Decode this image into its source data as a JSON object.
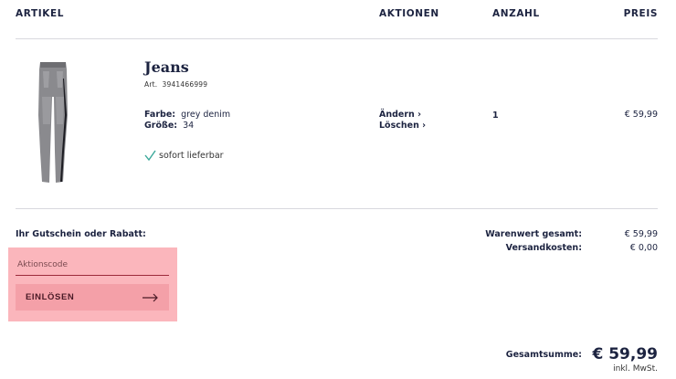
{
  "header": {
    "article": "ARTIKEL",
    "actions": "AKTIONEN",
    "quantity": "ANZAHL",
    "price": "PREIS"
  },
  "item": {
    "name": "Jeans",
    "article_label": "Art.",
    "article_number": "3941466999",
    "color_label": "Farbe:",
    "color_value": "grey denim",
    "size_label": "Größe:",
    "size_value": "34",
    "availability": "sofort lieferbar",
    "action_change": "Ändern",
    "action_delete": "Löschen",
    "quantity": "1",
    "price": "€ 59,99"
  },
  "voucher": {
    "label": "Ihr Gutschein oder Rabatt:",
    "placeholder": "Aktionscode",
    "redeem_label": "EINLÖSEN"
  },
  "summary": {
    "goods_total_label": "Warenwert gesamt:",
    "goods_total_value": "€ 59,99",
    "shipping_label": "Versandkosten:",
    "shipping_value": "€ 0,00",
    "grand_total_label": "Gesamtsumme:",
    "grand_total_value": "€ 59,99",
    "vat_note": "inkl. MwSt."
  },
  "colors": {
    "text": "#1c2340",
    "highlight": "#fbb6bc",
    "button": "#f4a0a8",
    "check": "#3aa89a"
  },
  "icons": {
    "check": "check-icon",
    "chevron": "chevron-right-icon",
    "arrow": "arrow-right-icon"
  }
}
